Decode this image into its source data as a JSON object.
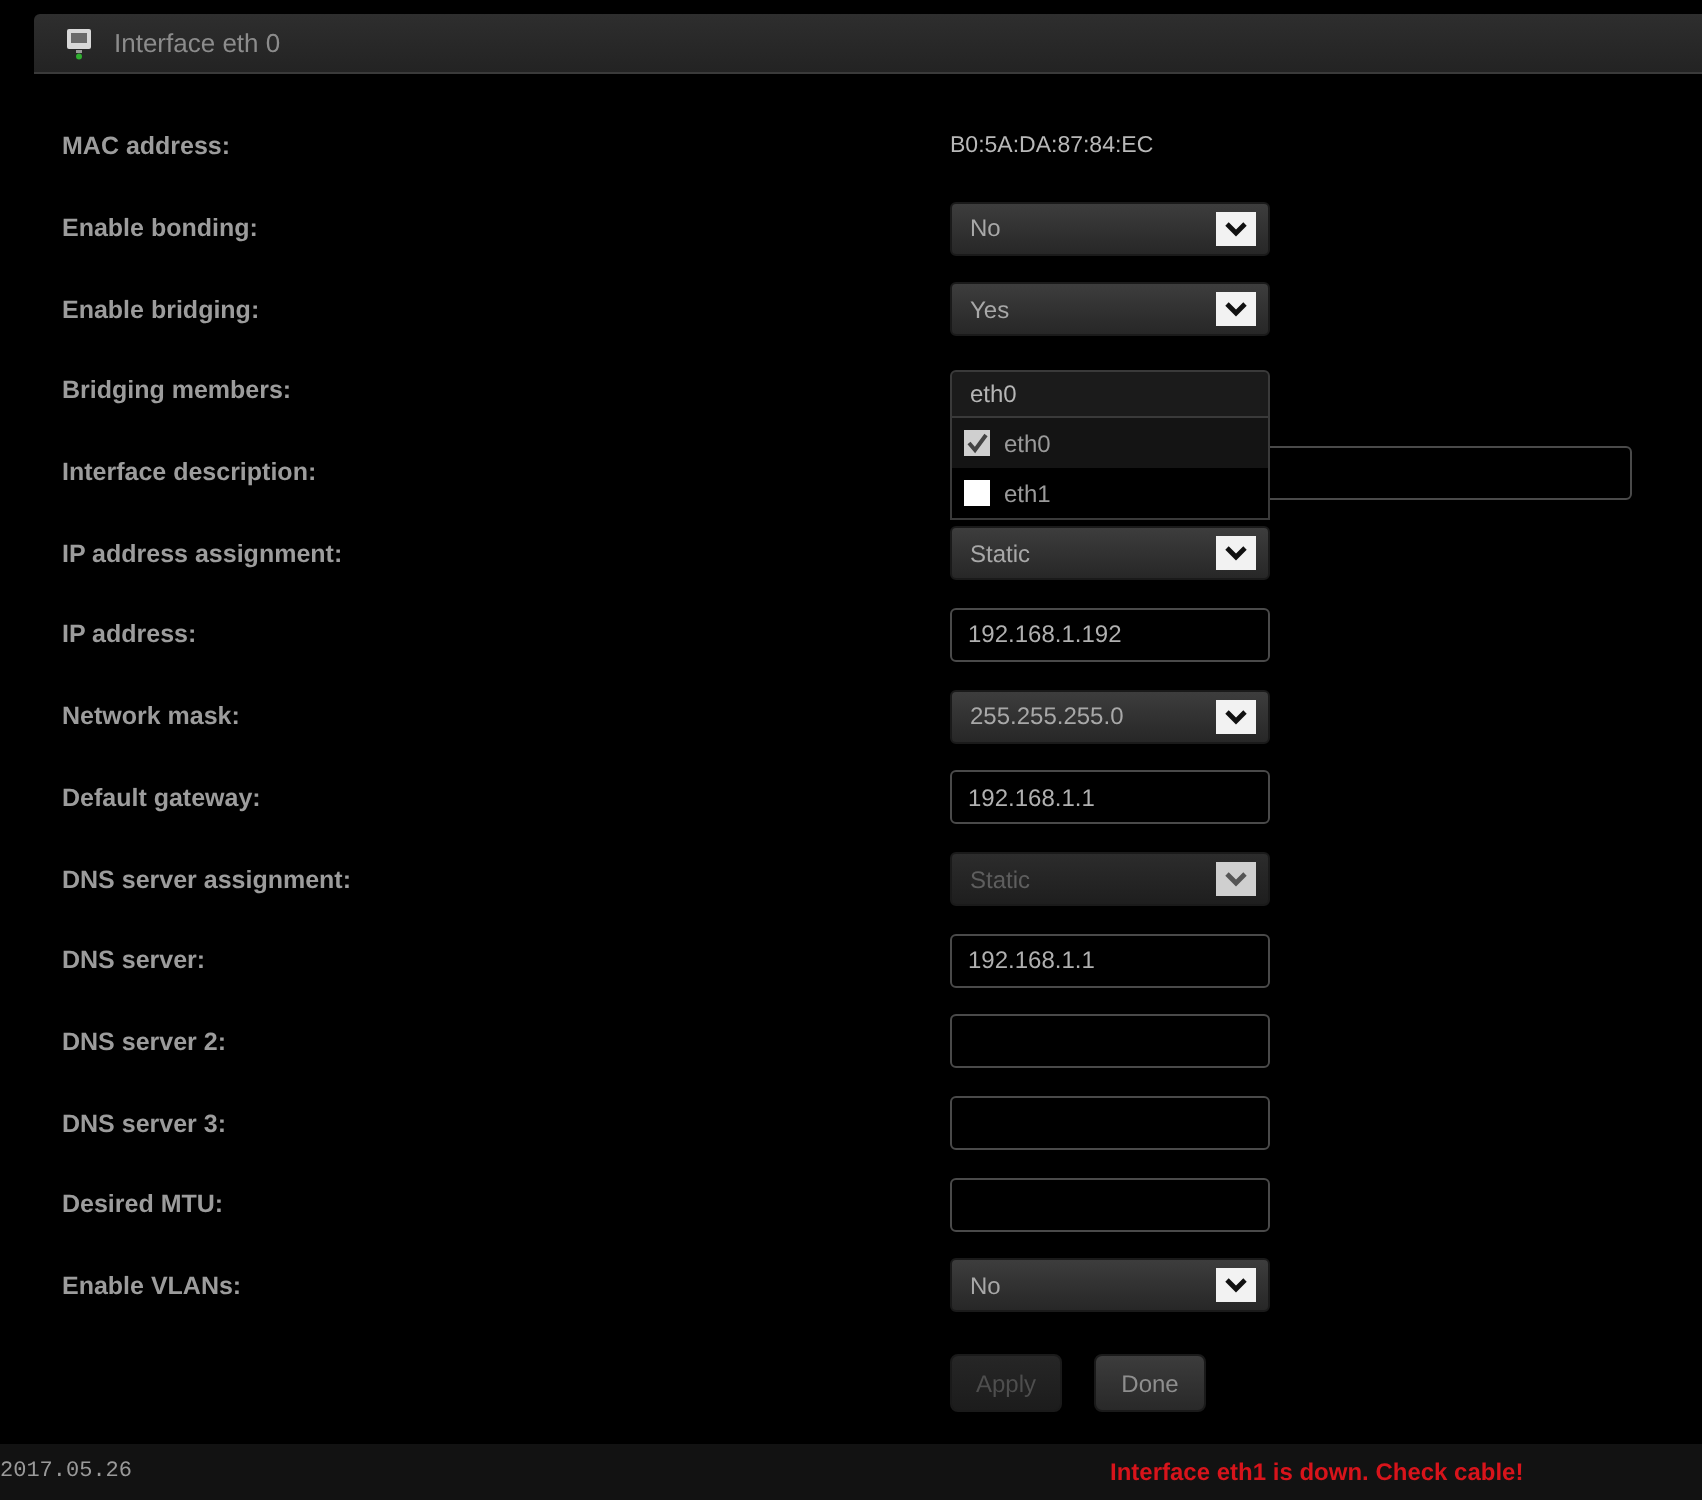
{
  "panel": {
    "title": "Interface eth 0"
  },
  "fields": [
    {
      "kind": "text",
      "label": "MAC address:",
      "value": "B0:5A:DA:87:84:EC"
    },
    {
      "kind": "select",
      "label": "Enable bonding:",
      "value": "No",
      "disabled": false
    },
    {
      "kind": "select",
      "label": "Enable bridging:",
      "value": "Yes",
      "disabled": false
    },
    {
      "kind": "multiselect",
      "label": "Bridging members:",
      "value": "eth0",
      "expanded": true,
      "options": [
        {
          "label": "eth0",
          "checked": true
        },
        {
          "label": "eth1",
          "checked": false
        }
      ]
    },
    {
      "kind": "input",
      "label": "Interface description:",
      "wide": true
    },
    {
      "kind": "select",
      "label": "IP address assignment:",
      "value": "Static",
      "disabled": false
    },
    {
      "kind": "input",
      "label": "IP address:",
      "value": "192.168.1.192",
      "wide": false
    },
    {
      "kind": "select",
      "label": "Network mask:",
      "value": "255.255.255.0",
      "disabled": false
    },
    {
      "kind": "input",
      "label": "Default gateway:",
      "value": "192.168.1.1",
      "wide": false
    },
    {
      "kind": "select",
      "label": "DNS server assignment:",
      "value": "Static",
      "disabled": true
    },
    {
      "kind": "input",
      "label": "DNS server:",
      "value": "192.168.1.1",
      "wide": false
    },
    {
      "kind": "input",
      "label": "DNS server 2:",
      "wide": false
    },
    {
      "kind": "input",
      "label": "DNS server 3:",
      "wide": false
    },
    {
      "kind": "input",
      "label": "Desired MTU:",
      "wide": false
    },
    {
      "kind": "select",
      "label": "Enable VLANs:",
      "value": "No",
      "disabled": false
    }
  ],
  "buttons": [
    {
      "label": "Apply",
      "disabled": true
    },
    {
      "label": "Done",
      "disabled": false
    }
  ],
  "status_bar": {
    "date": "2017.05.26",
    "message": "Interface eth1 is down. Check cable!"
  }
}
